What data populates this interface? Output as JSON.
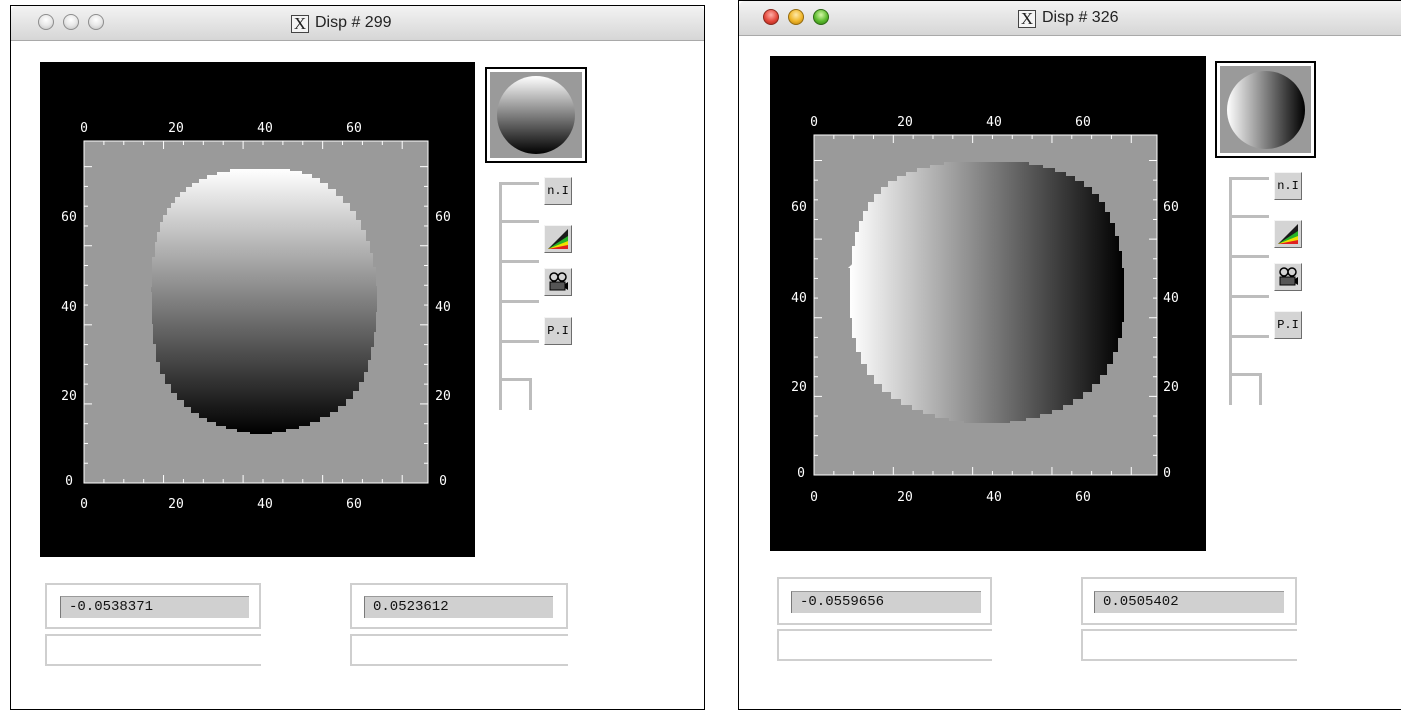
{
  "windows": [
    {
      "title": "Disp # 299",
      "title_icon": "X",
      "active": false,
      "gradient_direction": "vertical",
      "min_value": "-0.0538371",
      "max_value": "0.0523612",
      "axis_ticks": [
        "0",
        "20",
        "40",
        "60"
      ],
      "buttons": [
        {
          "name": "n-i-button",
          "label": "n.I"
        },
        {
          "name": "color-table-button",
          "icon": "color-wedge-icon"
        },
        {
          "name": "movie-button",
          "icon": "film-camera-icon"
        },
        {
          "name": "p-i-button",
          "label": "P.I"
        }
      ]
    },
    {
      "title": "Disp # 326",
      "title_icon": "X",
      "active": true,
      "gradient_direction": "horizontal",
      "min_value": "-0.0559656",
      "max_value": "0.0505402",
      "axis_ticks": [
        "0",
        "20",
        "40",
        "60"
      ],
      "buttons": [
        {
          "name": "n-i-button",
          "label": "n.I"
        },
        {
          "name": "color-table-button",
          "icon": "color-wedge-icon"
        },
        {
          "name": "movie-button",
          "icon": "film-camera-icon"
        },
        {
          "name": "p-i-button",
          "label": "P.I"
        }
      ]
    }
  ],
  "colors": {
    "plot_background": "#000000",
    "image_background": "#9a9a9a",
    "field_fill": "#d0d0d0"
  }
}
